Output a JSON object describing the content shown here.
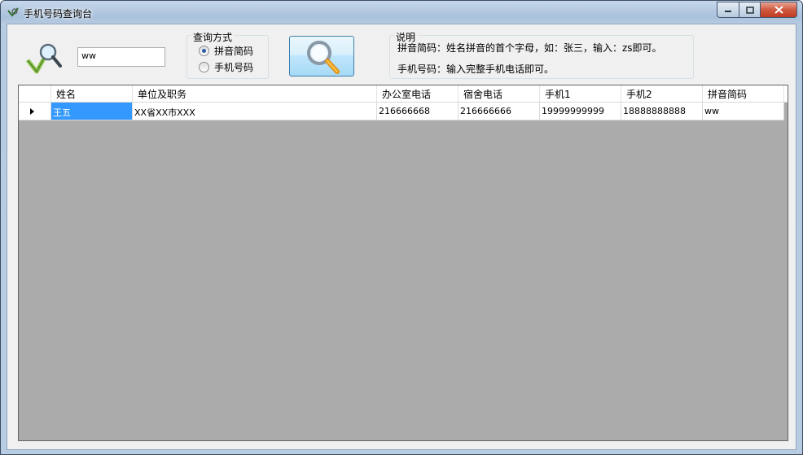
{
  "window": {
    "title": "手机号码查询台"
  },
  "search": {
    "value": "ww"
  },
  "query_method": {
    "title": "查询方式",
    "options": [
      {
        "label": "拼音简码",
        "checked": true
      },
      {
        "label": "手机号码",
        "checked": false
      }
    ]
  },
  "info": {
    "title": "说明",
    "line1": "拼音简码：姓名拼音的首个字母，如：张三，输入：zs即可。",
    "line2": "手机号码：输入完整手机电话即可。"
  },
  "grid": {
    "columns": [
      "姓名",
      "单位及职务",
      "办公室电话",
      "宿舍电话",
      "手机1",
      "手机2",
      "拼音简码"
    ],
    "rows": [
      [
        "王五",
        "XX省XX市XXX",
        "216666668",
        "216666666",
        "19999999999",
        "18888888888",
        "ww"
      ]
    ]
  },
  "colors": {
    "selection": "#3399ff",
    "grid_background": "#ababab",
    "close_button": "#c9452b"
  }
}
